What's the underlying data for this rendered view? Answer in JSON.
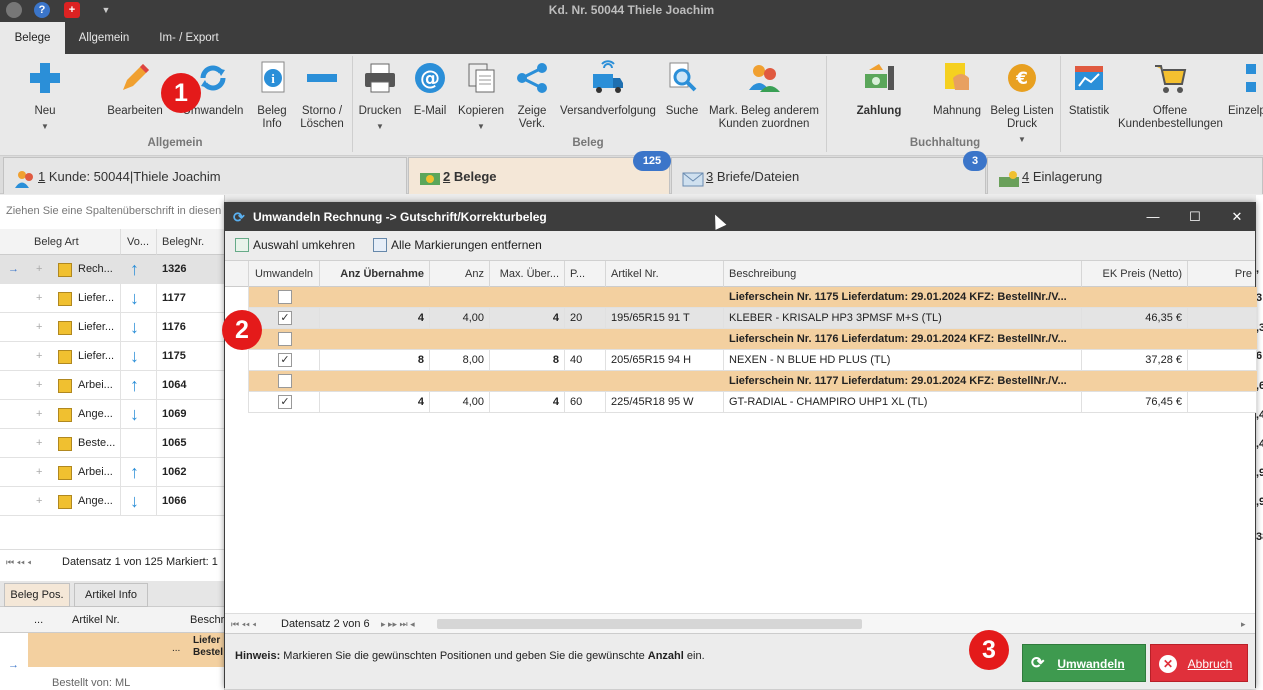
{
  "window": {
    "title": "Kd. Nr. 50044 Thiele Joachim"
  },
  "ribbon_tabs": [
    "Belege",
    "Allgemein",
    "Im- / Export"
  ],
  "ribbon": {
    "buttons": [
      {
        "label": "Neu",
        "icon": "plus-icon"
      },
      {
        "label": "Bearbeiten",
        "icon": "pencil-icon"
      },
      {
        "label": "Umwandeln",
        "icon": "convert-icon"
      },
      {
        "label": "Beleg\nInfo",
        "icon": "info-icon"
      },
      {
        "label": "Storno /\nLöschen",
        "icon": "minus-icon"
      },
      {
        "label": "Drucken",
        "icon": "printer-icon"
      },
      {
        "label": "E-Mail",
        "icon": "at-icon"
      },
      {
        "label": "Kopieren",
        "icon": "copy-icon"
      },
      {
        "label": "Zeige\nVerk.",
        "icon": "link-icon"
      },
      {
        "label": "Versandverfolgung",
        "icon": "truck-icon"
      },
      {
        "label": "Suche",
        "icon": "search-icon"
      },
      {
        "label": "Mark. Beleg  anderem\nKunden zuordnen",
        "icon": "users-icon"
      },
      {
        "label": "Zahlung",
        "icon": "payment-icon"
      },
      {
        "label": "Mahnung",
        "icon": "reminder-icon"
      },
      {
        "label": "Beleg Listen\nDruck",
        "icon": "euro-icon"
      },
      {
        "label": "Statistik",
        "icon": "chart-icon"
      },
      {
        "label": "Offene\nKundenbestellungen",
        "icon": "cart-icon"
      },
      {
        "label": "Einzelp",
        "icon": "tree-icon"
      }
    ],
    "groups": [
      "Allgemein",
      "Beleg",
      "Buchhaltung"
    ]
  },
  "main_tabs": [
    {
      "num": "1",
      "label": "Kunde: 50044|Thiele Joachim"
    },
    {
      "num": "2",
      "label": "Belege",
      "badge": "125"
    },
    {
      "num": "3",
      "label": "Briefe/Dateien",
      "badge": "3"
    },
    {
      "num": "4",
      "label": "Einlagerung"
    }
  ],
  "background_grid": {
    "hint": "Ziehen Sie eine Spaltenüberschrift in diesen B",
    "columns": [
      "Beleg Art",
      "Vo...",
      "BelegNr."
    ],
    "rows": [
      {
        "art": "Rech...",
        "dir": "up",
        "nr": "1326"
      },
      {
        "art": "Liefer...",
        "dir": "down",
        "nr": "1177"
      },
      {
        "art": "Liefer...",
        "dir": "down",
        "nr": "1176"
      },
      {
        "art": "Liefer...",
        "dir": "down",
        "nr": "1175"
      },
      {
        "art": "Arbei...",
        "dir": "up",
        "nr": "1064"
      },
      {
        "art": "Ange...",
        "dir": "down",
        "nr": "1069"
      },
      {
        "art": "Beste...",
        "dir": "",
        "nr": "1065"
      },
      {
        "art": "Arbei...",
        "dir": "up",
        "nr": "1062"
      },
      {
        "art": "Ange...",
        "dir": "down",
        "nr": "1066"
      }
    ],
    "footer": "Datensatz 1 von 125 Markiert: 1",
    "lower_tabs": [
      "Beleg Pos.",
      "Artikel Info"
    ],
    "lower_columns": [
      "...",
      "Artikel Nr.",
      "Beschr"
    ],
    "lower_row": {
      "dots": "...",
      "text1": "Liefer",
      "text2": "Bestel"
    },
    "lower_note": "Bestellt von: ML",
    "right_cut": [
      ",",
      "3",
      ",3",
      "6",
      ",6",
      ",4",
      ",4",
      ",9",
      ",9",
      "38"
    ]
  },
  "modal": {
    "title": "Umwandeln Rechnung -> Gutschrift/Korrekturbeleg",
    "toolbar": [
      "Auswahl umkehren",
      "Alle Markierungen entfernen"
    ],
    "columns": [
      "Umwandeln",
      "Anz Übernahme",
      "Anz",
      "Max. Über...",
      "P...",
      "Artikel Nr.",
      "Beschreibung",
      "EK Preis (Netto)",
      "Pre"
    ],
    "groups": [
      {
        "header": "Lieferschein Nr. 1175 Lieferdatum: 29.01.2024 KFZ:  BestellNr./V...",
        "row": {
          "checked": "✓",
          "anz_ueb": "4",
          "anz": "4,00",
          "max": "4",
          "p": "20",
          "artikel": "195/65R15 91 T",
          "beschreibung": "KLEBER - KRISALP HP3 3PMSF M+S (TL)",
          "ek": "46,35 €"
        }
      },
      {
        "header": "Lieferschein Nr. 1176 Lieferdatum: 29.01.2024 KFZ:  BestellNr./V...",
        "row": {
          "checked": "✓",
          "anz_ueb": "8",
          "anz": "8,00",
          "max": "8",
          "p": "40",
          "artikel": "205/65R15 94 H",
          "beschreibung": "NEXEN - N BLUE HD PLUS (TL)",
          "ek": "37,28 €"
        }
      },
      {
        "header": "Lieferschein Nr. 1177 Lieferdatum: 29.01.2024 KFZ:  BestellNr./V...",
        "row": {
          "checked": "✓",
          "anz_ueb": "4",
          "anz": "4,00",
          "max": "4",
          "p": "60",
          "artikel": "225/45R18 95 W",
          "beschreibung": "GT-RADIAL - CHAMPIRO UHP1 XL (TL)",
          "ek": "76,45 €"
        }
      }
    ],
    "footer": "Datensatz 2 von 6",
    "hint_label": "Hinweis:",
    "hint_text": "Markieren Sie die gewünschten Positionen und geben Sie die gewünschte",
    "hint_bold": "Anzahl",
    "hint_end": "ein.",
    "ok_label": "Umwandeln",
    "cancel_label": "Abbruch"
  },
  "markers": [
    "1",
    "2",
    "3"
  ],
  "colors": {
    "accent": "#3b75c9",
    "group_row": "#f3d0a0",
    "ok": "#3e9a4f",
    "cancel": "#e0303b",
    "marker": "#e41a1a"
  }
}
